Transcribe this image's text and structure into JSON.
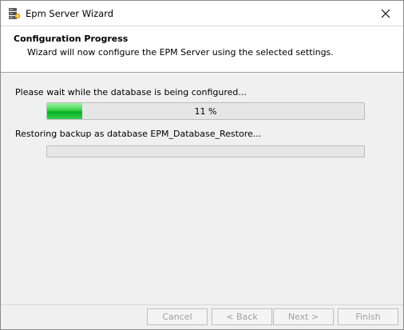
{
  "window": {
    "title": "Epm Server Wizard"
  },
  "header": {
    "title": "Configuration Progress",
    "subtitle": "Wizard will now configure the EPM Server using the selected settings."
  },
  "main": {
    "status_line1": "Please wait while the database is being configured...",
    "progress1": {
      "value": 0.11,
      "label": "11 %"
    },
    "status_line2": "Restoring backup as database EPM_Database_Restore...",
    "progress2": {
      "value": 0
    }
  },
  "buttons": {
    "cancel": "Cancel",
    "back": "< Back",
    "next": "Next >",
    "finish": "Finish"
  },
  "icons": {
    "app": "server-icon",
    "close": "close-icon"
  },
  "colors": {
    "progress_fill": "#06b025",
    "disabled_text": "#a0a0a0"
  }
}
